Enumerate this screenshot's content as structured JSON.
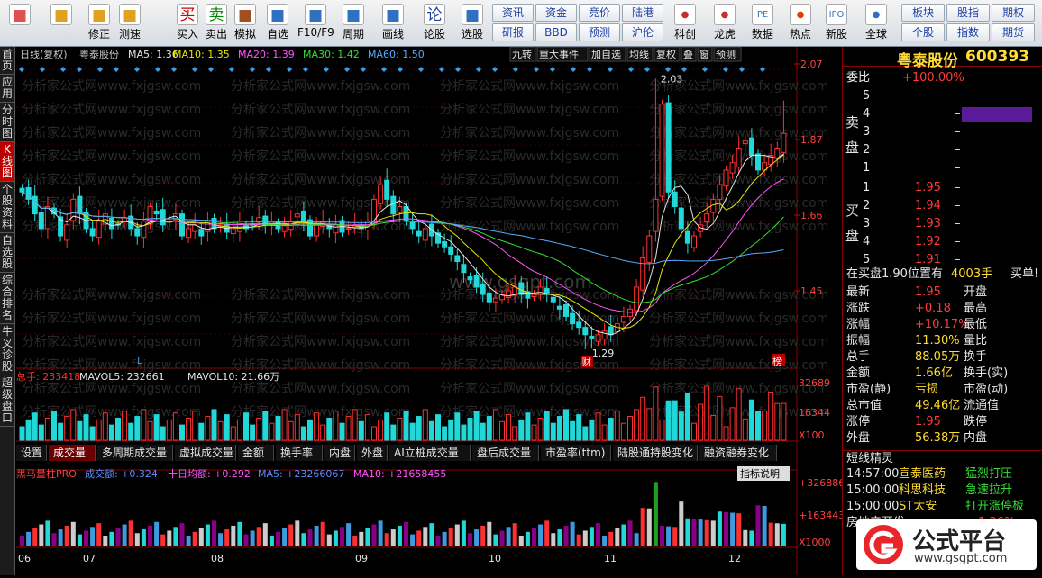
{
  "toolbar": {
    "items": [
      {
        "name": "home",
        "label": "",
        "icon": "grid-icon",
        "color": "#e05050"
      },
      {
        "name": "back",
        "label": "",
        "icon": "arrow-left-icon",
        "color": "#e0a020"
      },
      {
        "name": "modify",
        "label": "修正",
        "icon": "arrow-updown-icon",
        "color": "#e0a020"
      },
      {
        "name": "speedtest",
        "label": "测速",
        "icon": "clock-icon",
        "color": "#e0a020"
      },
      {
        "name": "buy",
        "label": "买入",
        "icon": "buy-icon",
        "char": "买",
        "color": "#d00000"
      },
      {
        "name": "sell",
        "label": "卖出",
        "icon": "sell-icon",
        "char": "卖",
        "color": "#008800"
      },
      {
        "name": "simulate",
        "label": "模拟",
        "icon": "hammer-icon",
        "color": "#a05020"
      },
      {
        "name": "watchlist",
        "label": "自选",
        "icon": "watchlist-icon",
        "color": "#3070c0"
      },
      {
        "name": "f10",
        "label": "F10/F9",
        "icon": "f10-icon",
        "color": "#3070c0"
      },
      {
        "name": "period",
        "label": "周期",
        "icon": "period-icon",
        "color": "#3070c0"
      },
      {
        "name": "drawline",
        "label": "画线",
        "icon": "pencil-icon",
        "color": "#3070c0"
      },
      {
        "name": "discuss",
        "label": "论股",
        "icon": "discuss-icon",
        "char": "论",
        "color": "#2040a0"
      },
      {
        "name": "picker",
        "label": "选股",
        "icon": "picker-icon",
        "color": "#3070c0"
      }
    ],
    "grid1": [
      "资讯",
      "资金",
      "竞价",
      "陆港",
      "研报",
      "BBD",
      "预测",
      "沪伦"
    ],
    "items2": [
      {
        "name": "kechuang",
        "label": "科创",
        "icon": "kechuang-icon",
        "color": "#c03030"
      },
      {
        "name": "longhu",
        "label": "龙虎",
        "icon": "longhu-icon",
        "color": "#c03030"
      },
      {
        "name": "data",
        "label": "数据",
        "icon": "pe-icon",
        "char": "PE",
        "color": "#3070c0"
      },
      {
        "name": "hot",
        "label": "热点",
        "icon": "fire-icon",
        "color": "#e04000"
      },
      {
        "name": "ipo",
        "label": "新股",
        "icon": "ipo-icon",
        "char": "IPO",
        "color": "#3070c0"
      },
      {
        "name": "global",
        "label": "全球",
        "icon": "globe-icon",
        "color": "#3070c0"
      }
    ],
    "grid2": [
      "板块",
      "股指",
      "期权",
      "个股",
      "指数",
      "期货"
    ]
  },
  "lefttabs": [
    "首页",
    "应用",
    "分时图",
    "K线图",
    "个股资料",
    "自选股",
    "综合排名",
    "牛叉诊股",
    "超级盘口"
  ],
  "header": {
    "period": "日线(复权)",
    "stock": "粤泰股份",
    "ma5": "MA5: 1.36",
    "ma10": "MA10: 1.35",
    "ma20": "MA20: 1.39",
    "ma30": "MA30: 1.42",
    "ma60": "MA60: 1.50",
    "buttons": [
      "九转",
      "重大事件",
      "加自选",
      "均线",
      "复权",
      "叠",
      "窗",
      "预测"
    ]
  },
  "colors": {
    "ma5": "#e6e6e6",
    "ma10": "#e6e600",
    "ma20": "#ff55ff",
    "ma30": "#33dd33",
    "ma60": "#55aaff",
    "up": "#ff3030",
    "down": "#20d8d8"
  },
  "price_axis": [
    "2.07",
    "1.87",
    "1.66",
    "1.45"
  ],
  "annotations": {
    "high": "2.03",
    "low": "1.29",
    "cai": "财",
    "bang": "榜",
    "l": "L"
  },
  "watermark": {
    "main": "分析家公式网www.fxjgsw.com",
    "site": "www.gsgpt.com"
  },
  "vol": {
    "title": "总手: 233418",
    "mav5": "MAVOL5: 232661",
    "mav10": "MAVOL10: 21.66万",
    "axis": [
      "32689",
      "16344",
      "X100"
    ]
  },
  "subtabs": [
    "设置",
    "成交量",
    "多周期成交量",
    "虚拟成交量",
    "金额",
    "换手率",
    "内盘",
    "外盘",
    "AI立桩成交量",
    "盘后成交量",
    "市盈率(ttm)",
    "陆股通持股变化",
    "融资融券变化"
  ],
  "ind": {
    "title": "黑马量柱PRO",
    "a": "成交额: +0.324",
    "b": "十日均额: +0.292",
    "c": "MA5: +23266067",
    "d": "MA10: +21658455",
    "help": "指标说明",
    "axis": [
      "+326886",
      "+163443",
      "X1000"
    ]
  },
  "months": [
    "06",
    "07",
    "08",
    "09",
    "10",
    "11",
    "12"
  ],
  "right": {
    "name": "粤泰股份",
    "code": "600393",
    "weibi_label": "委比",
    "weibi": "+100.00%",
    "sell_label": [
      "卖",
      "盘"
    ],
    "buy_label": [
      "买",
      "盘"
    ],
    "sell": [
      {
        "n": "5",
        "p": "",
        "v": ""
      },
      {
        "n": "4",
        "p": "",
        "v": "–"
      },
      {
        "n": "3",
        "p": "",
        "v": "–"
      },
      {
        "n": "2",
        "p": "",
        "v": "–"
      },
      {
        "n": "1",
        "p": "",
        "v": "–"
      }
    ],
    "buy": [
      {
        "n": "1",
        "p": "1.95",
        "v": "–"
      },
      {
        "n": "2",
        "p": "1.94",
        "v": "–"
      },
      {
        "n": "3",
        "p": "1.93",
        "v": "–"
      },
      {
        "n": "4",
        "p": "1.92",
        "v": "–"
      },
      {
        "n": "5",
        "p": "1.91",
        "v": "–"
      }
    ],
    "note": "在买盘1.90位置有",
    "note_val": "4003手",
    "note_tag": "买单!",
    "stats": [
      [
        "最新",
        "1.95",
        "开盘",
        ""
      ],
      [
        "涨跌",
        "+0.18",
        "最高",
        ""
      ],
      [
        "涨幅",
        "+10.17%",
        "最低",
        ""
      ],
      [
        "振幅",
        "11.30%",
        "量比",
        ""
      ],
      [
        "总手",
        "88.05万",
        "换手",
        ""
      ],
      [
        "金额",
        "1.66亿",
        "换手(实)",
        ""
      ],
      [
        "市盈(静)",
        "亏损",
        "市盈(动)",
        ""
      ],
      [
        "总市值",
        "49.46亿",
        "流通值",
        ""
      ],
      [
        "涨停",
        "1.95",
        "跌停",
        ""
      ],
      [
        "外盘",
        "56.38万",
        "内盘",
        ""
      ]
    ],
    "news_title": "短线精灵",
    "news": [
      [
        "14:57:00",
        "宣泰医药",
        "猛烈打压"
      ],
      [
        "15:00:00",
        "科思科技",
        "急速拉升"
      ],
      [
        "15:00:00",
        "ST太安",
        "打开涨停板"
      ]
    ],
    "sector": "房地产开发",
    "sector_pct": "1.36%",
    "logo": "公式平台",
    "logo_url": "www.gsgpt.com"
  }
}
